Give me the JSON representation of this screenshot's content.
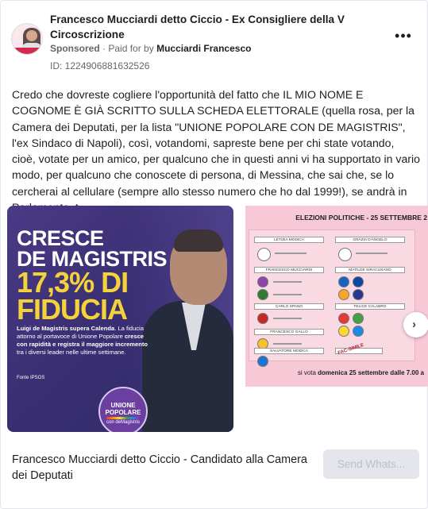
{
  "header": {
    "page_name": "Francesco Mucciardi detto Ciccio - Ex Consigliere della V Circoscrizione",
    "sponsored_label": "Sponsored",
    "paid_for_prefix": "Paid for by",
    "paid_for_name": "Mucciardi Francesco",
    "ad_id": "ID: 1224906881632526",
    "more_glyph": "•••"
  },
  "body_text": "Credo che dovreste cogliere l'opportunità del fatto che IL MIO NOME E COGNOME È GIÀ SCRITTO SULLA SCHEDA ELETTORALE (quella rosa, per la Camera dei Deputati, per la lista \"UNIONE POPOLARE CON DE MAGISTRIS\", l'ex Sindaco di Napoli), così, votandomi, sapreste bene per chi state votando, cioè, votate per un amico, per qualcuno che in questi anni vi ha supportato in vario modo, per qualcuno che conoscete di persona, di Messina, che sai che, se lo cercherai al cellulare (sempre allo stesso numero che ho dal 1999!), se andrà in Parlamento, t...",
  "carousel": {
    "slide1": {
      "headline_line1": "CRESCE",
      "headline_line2": "DE MAGISTRIS",
      "headline_line3": "17,3% DI",
      "headline_line4": "FIDUCIA",
      "desc_bold1": "Luigi de Magistris supera Calenda",
      "desc_normal1": ". La fiducia attorno al portavoce di Unione Popolare ",
      "desc_bold2": "cresce con rapidità e registra il maggiore incremento",
      "desc_normal2": " tra i diversi leader nelle ultime settimane.",
      "source": "Fonte IPSOS",
      "logo_line1": "UNIONE",
      "logo_line2": "POPOLARE",
      "logo_line3": "con deMagistris"
    },
    "slide2": {
      "title": "ELEZIONI POLITICHE - 25 SETTEMBRE 2",
      "columns": [
        "LETIZIA MODICA",
        "GRAZIA D'ANGELO",
        "FRANCESCO MUCCIARDI",
        "MATILDE SIRACUSANO",
        "CARLO SPANO",
        "FELICE CALABRO",
        "FRANCESCO GALLO",
        "SALVATORE MODICA"
      ],
      "watermark": "FAC-SIMILE",
      "footer_text": "si vota ",
      "footer_bold": "domenica 25 settembre dalle 7.00 a"
    },
    "next_glyph": "›"
  },
  "footer": {
    "cta_title": "Francesco Mucciardi detto Ciccio - Candidato alla Camera dei Deputati",
    "send_button": "Send Whats..."
  },
  "colors": {
    "slide1_bg": "#3a2f73",
    "headline_yellow": "#f4d23a",
    "slide2_bg": "#f7c9d6",
    "button_bg": "#e4e6eb"
  }
}
